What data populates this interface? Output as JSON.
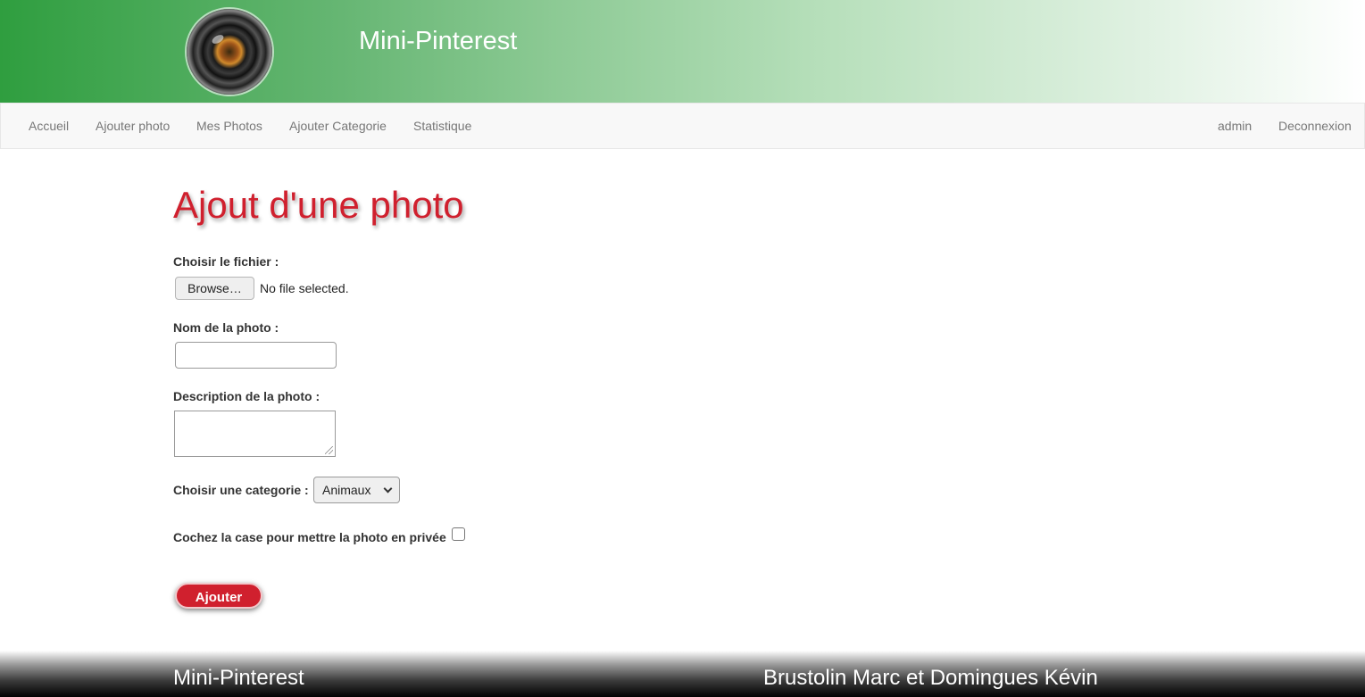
{
  "header": {
    "site_title": "Mini-Pinterest",
    "logo_icon": "camera-lens-icon"
  },
  "nav": {
    "left": [
      "Accueil",
      "Ajouter photo",
      "Mes Photos",
      "Ajouter Categorie",
      "Statistique"
    ],
    "right": [
      "admin",
      "Deconnexion"
    ]
  },
  "form": {
    "title": "Ajout d'une photo",
    "file_label": "Choisir le fichier :",
    "browse_label": "Browse…",
    "file_status": "No file selected.",
    "name_label": "Nom de la photo :",
    "name_value": "",
    "description_label": "Description de la photo :",
    "description_value": "",
    "category_label": "Choisir une categorie :",
    "category_selected": "Animaux",
    "private_label": "Cochez la case pour mettre la photo en privée",
    "private_checked": false,
    "submit_label": "Ajouter"
  },
  "footer": {
    "left": "Mini-Pinterest",
    "right": "Brustolin Marc et Domingues Kévin"
  },
  "colors": {
    "accent": "#d0202e",
    "header_green": "#2f9e3f"
  }
}
